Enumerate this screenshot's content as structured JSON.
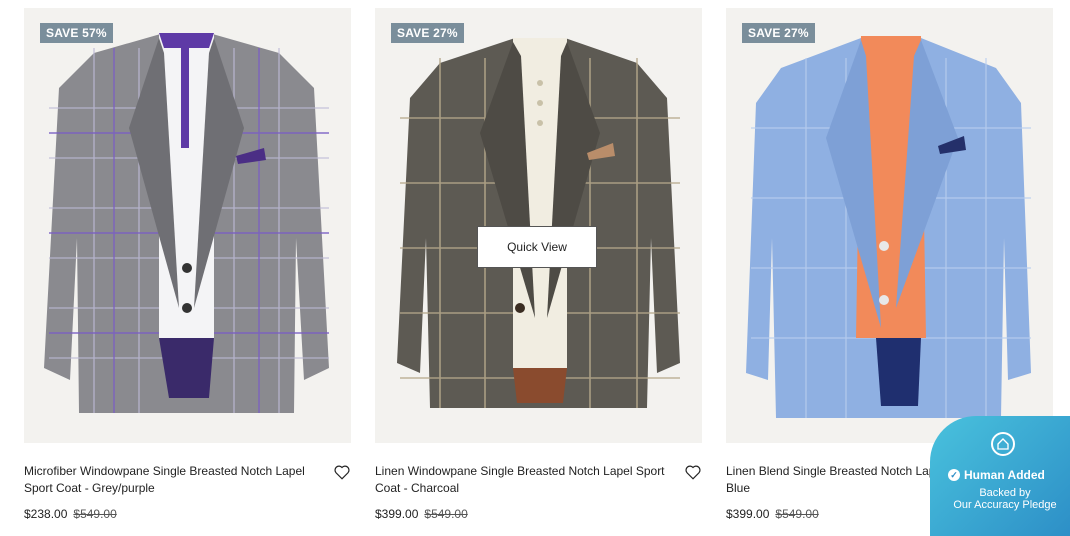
{
  "products": [
    {
      "badge": "SAVE 57%",
      "name": "Microfiber Windowpane Single Breasted Notch Lapel Sport Coat - Grey/purple",
      "price": "$238.00",
      "original_price": "$549.00",
      "jacket_color": "#8a8a8f",
      "shirt_color": "#f4f4f6",
      "accent_color": "#5e3aa6"
    },
    {
      "badge": "SAVE 27%",
      "name": "Linen Windowpane Single Breasted Notch Lapel Sport Coat - Charcoal",
      "price": "$399.00",
      "original_price": "$549.00",
      "jacket_color": "#5d5a53",
      "shirt_color": "#f1ede1",
      "accent_color": "#b98d6a",
      "quick_view": "Quick View"
    },
    {
      "badge": "SAVE 27%",
      "name": "Linen Blend Single Breasted Notch Lapel Sport Coat - Blue",
      "price": "$399.00",
      "original_price": "$549.00",
      "jacket_color": "#8fb0e2",
      "shirt_color": "#f28a5a",
      "accent_color": "#1f2f6f"
    }
  ],
  "pledge": {
    "status": "Human Added",
    "line1": "Backed by",
    "line2": "Our Accuracy Pledge"
  },
  "icons": {
    "favorite": "heart-outline-icon",
    "pledge_logo": "house-icon",
    "check": "check-circle-icon"
  }
}
